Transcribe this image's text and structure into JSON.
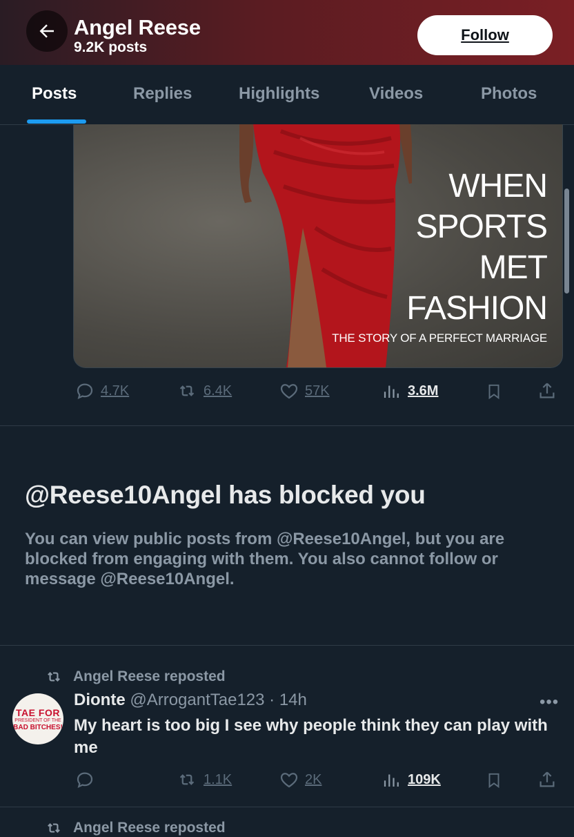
{
  "header": {
    "name": "Angel Reese",
    "posts_count": "9.2K posts",
    "follow_label": "Follow",
    "back_icon": "arrow-left-icon"
  },
  "tabs": [
    {
      "label": "Posts",
      "active": true
    },
    {
      "label": "Replies",
      "active": false
    },
    {
      "label": "Highlights",
      "active": false
    },
    {
      "label": "Videos",
      "active": false
    },
    {
      "label": "Photos",
      "active": false
    }
  ],
  "post1": {
    "media": {
      "headline": [
        "WHEN",
        "SPORTS",
        "MET",
        "FASHION"
      ],
      "subtitle": "THE STORY OF A PERFECT MARRIAGE"
    },
    "actions": {
      "replies": "4.7K",
      "reposts": "6.4K",
      "likes": "57K",
      "views": "3.6M"
    }
  },
  "blocked": {
    "title": "@Reese10Angel has blocked you",
    "message": "You can view public posts from @Reese10Angel, but you are blocked from engaging with them. You also cannot follow or message @Reese10Angel."
  },
  "post2": {
    "repost_label": "Angel Reese reposted",
    "author_name": "Dionte",
    "handle_time": "@ArrogantTae123 · 14h",
    "text": "My heart is too big I see why people think they can play with me",
    "avatar": {
      "line1": "TAE FOR",
      "line2": "PRESIDENT OF THE",
      "line3": "BAD BITCHES!"
    },
    "actions": {
      "replies": "",
      "reposts": "1.1K",
      "likes": "2K",
      "views": "109K"
    }
  },
  "next_repost_label": "Angel Reese reposted",
  "colors": {
    "background": "#15202b",
    "accent": "#1d9bf0",
    "header_gradient_end": "#7a1f24",
    "dress": "#b3151c"
  }
}
